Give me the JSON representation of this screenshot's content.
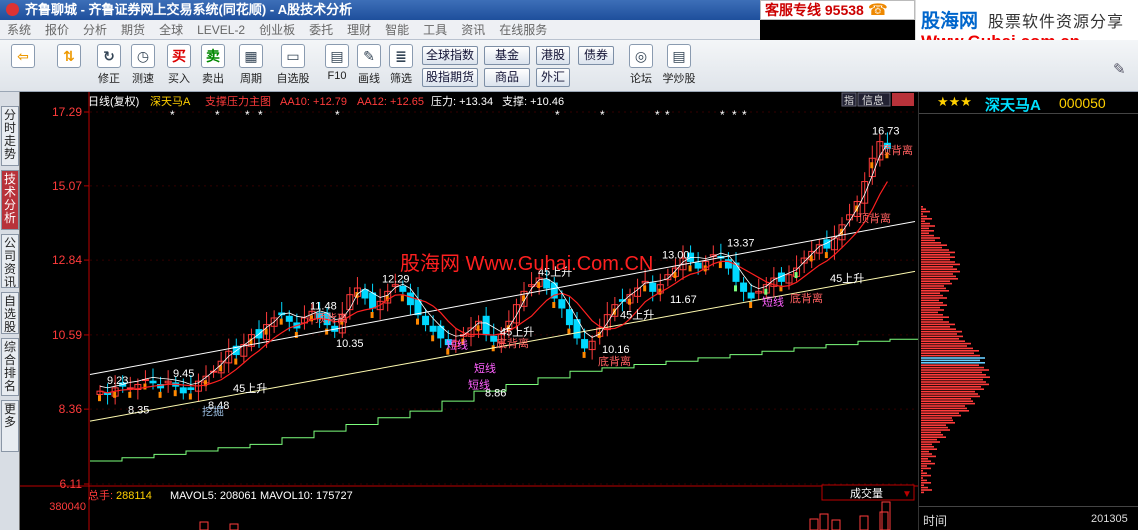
{
  "window": {
    "title": "齐鲁聊城 - 齐鲁证券网上交易系统(同花顺) - A股技术分析",
    "hotline_label": "客服专线",
    "hotline_number": "95538",
    "phone_icon": "phone-icon"
  },
  "menu": [
    "系统",
    "报价",
    "分析",
    "期货",
    "全球",
    "LEVEL-2",
    "创业板",
    "委托",
    "理财",
    "智能",
    "工具",
    "资讯",
    "在线服务"
  ],
  "ad": {
    "logo": "股海网",
    "slogan": "股票软件资源分享",
    "url": "Www.Guhai.com.cn"
  },
  "toolbar": {
    "tools": [
      {
        "label": "",
        "icon": "back-arrow-icon"
      },
      {
        "label": "",
        "icon": "up-down-arrow-icon"
      },
      {
        "label": "修正",
        "icon": "refresh-icon"
      },
      {
        "label": "测速",
        "icon": "clock-icon"
      },
      {
        "label": "买入",
        "icon": "buy-icon",
        "glyph": "买"
      },
      {
        "label": "卖出",
        "icon": "sell-icon",
        "glyph": "卖"
      },
      {
        "label": "周期",
        "icon": "calendar-icon"
      },
      {
        "label": "自选股",
        "icon": "folder-icon"
      },
      {
        "label": "F10",
        "icon": "document-icon"
      },
      {
        "label": "画线",
        "icon": "pencil-icon"
      },
      {
        "label": "筛选",
        "icon": "filter-icon"
      },
      {
        "label": "论坛",
        "icon": "forum-icon"
      },
      {
        "label": "学炒股",
        "icon": "book-icon"
      }
    ],
    "buttons": [
      "全球指数",
      "基金",
      "港股",
      "债券",
      "股指期货",
      "商品",
      "外汇"
    ]
  },
  "sidetabs": [
    "分时走势",
    "技术分析",
    "公司资讯",
    "自选股",
    "综合排名",
    "更多"
  ],
  "chart_header": {
    "period": "日线(复权)",
    "stock": "深天马A",
    "formula": "支撑压力主图",
    "aa10": "AA10: +12.79",
    "aa12": "AA12: +12.65",
    "pressure": "压力: +13.34",
    "support": "支撑: +10.46",
    "tab1": "指",
    "tab2": "信息"
  },
  "yticks": [
    "17.29",
    "15.07",
    "12.84",
    "10.59",
    "8.36",
    "6.11"
  ],
  "watermark": "股海网 Www.Guhai.Com.CN",
  "annotations": [
    "16.73",
    "顶背离",
    "顶背离",
    "13.37",
    "13.00",
    "12.29",
    "11.48",
    "顶背离",
    "11.67",
    "10.35",
    "9.45",
    "9.23",
    "8.35",
    "8.48",
    "10.16",
    "8.86",
    "45上升",
    "45上升",
    "45上升",
    "45上升",
    "45上升",
    "底背离",
    "底背离",
    "底背离",
    "短线",
    "短线",
    "短线",
    "短线",
    "挖掘"
  ],
  "volume": {
    "label": "总手:",
    "value": "288114",
    "mavol5": "MAVOL5: 208061",
    "mavol10": "MAVOL10: 175727",
    "top": "380040",
    "dropdown": "成交量"
  },
  "right_panel": {
    "name": "深天马A",
    "code": "000050",
    "time_label": "时间",
    "date_fragment": "201305"
  },
  "colors": {
    "bull": "#ff3b3b",
    "bear": "#00d8ff",
    "orange": "#ff8800",
    "lime": "#7dff7d"
  },
  "chart_data": {
    "type": "candlestick",
    "ylim": [
      6.11,
      17.29
    ],
    "highs": [
      9.23,
      9.45,
      12.29,
      11.48,
      13.0,
      13.37,
      16.73
    ],
    "lows": [
      8.35,
      8.48,
      10.35,
      8.86,
      10.16,
      11.67
    ],
    "pressure": 13.34,
    "support": 10.46,
    "aa10": 12.79,
    "aa12": 12.65,
    "closes": [
      8.9,
      8.8,
      9.0,
      9.05,
      9.0,
      9.1,
      9.25,
      9.15,
      9.0,
      9.2,
      9.05,
      8.85,
      8.95,
      9.2,
      9.35,
      9.5,
      9.8,
      10.1,
      10.0,
      10.3,
      10.6,
      10.5,
      10.9,
      11.1,
      11.2,
      11.0,
      10.8,
      11.1,
      11.3,
      11.1,
      10.9,
      10.7,
      11.2,
      11.8,
      12.0,
      11.7,
      11.4,
      11.6,
      11.9,
      12.1,
      11.9,
      11.5,
      11.2,
      10.9,
      10.7,
      10.5,
      10.3,
      10.4,
      10.6,
      10.8,
      11.0,
      10.6,
      10.4,
      10.6,
      11.0,
      11.5,
      11.9,
      12.1,
      12.3,
      12.0,
      11.7,
      11.4,
      10.9,
      10.5,
      10.2,
      10.4,
      10.8,
      11.2,
      11.5,
      11.6,
      11.8,
      12.0,
      12.2,
      11.9,
      12.1,
      12.4,
      12.6,
      12.9,
      12.8,
      12.6,
      12.8,
      13.0,
      12.9,
      12.6,
      12.2,
      11.9,
      11.7,
      11.9,
      12.1,
      12.3,
      12.2,
      12.4,
      12.6,
      12.9,
      13.1,
      13.3,
      13.2,
      13.5,
      13.9,
      14.2,
      14.6,
      15.2,
      15.9,
      16.4,
      16.2
    ]
  }
}
